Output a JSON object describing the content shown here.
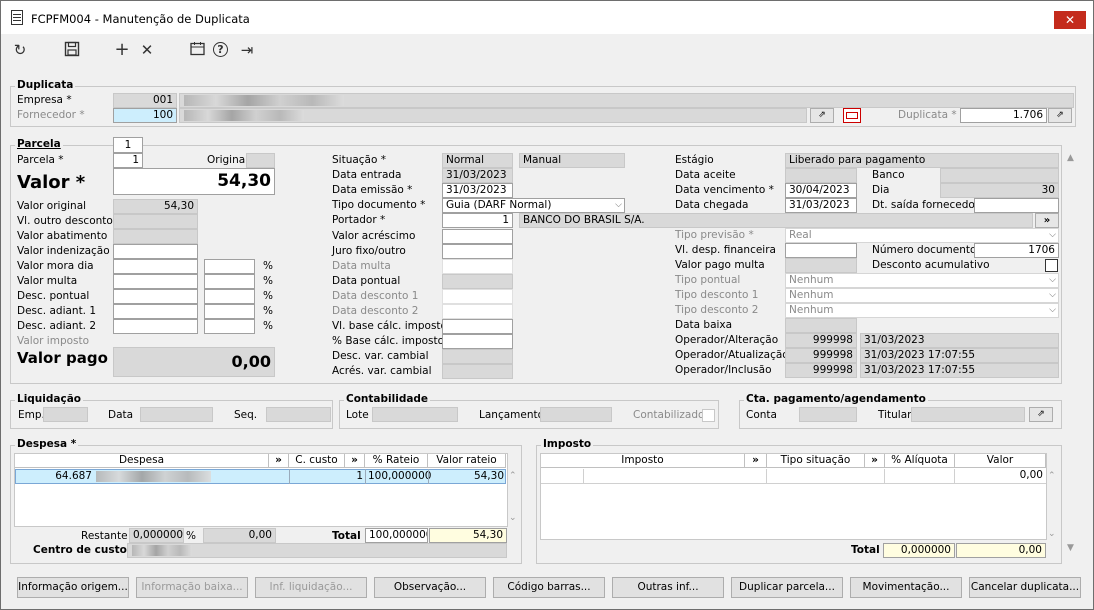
{
  "window": {
    "title": "FCPFM004 - Manutenção de Duplicata"
  },
  "toolbar": {
    "refresh": "↻",
    "save": "💾",
    "add": "+",
    "delete": "✕",
    "calendar": "📅",
    "help": "?",
    "exit": "⇥"
  },
  "duplicata": {
    "section": "Duplicata",
    "empresa_label": "Empresa *",
    "empresa": "001",
    "fornecedor_label": "Fornecedor *",
    "fornecedor": "100",
    "duplicata_label": "Duplicata *",
    "duplicata": "1.706"
  },
  "parcela": {
    "section": "Parcela",
    "tab": "1",
    "parcela_label": "Parcela *",
    "parcela": "1",
    "original_label": "Original",
    "valor_label": "Valor *",
    "valor": "54,30",
    "rows": [
      {
        "label": "Valor original",
        "value": "54,30"
      },
      {
        "label": "Vl. outro desconto",
        "value": ""
      },
      {
        "label": "Valor abatimento",
        "value": ""
      },
      {
        "label": "Valor indenização",
        "value": ""
      },
      {
        "label": "Valor mora dia",
        "value": ""
      },
      {
        "label": "Valor multa",
        "value": ""
      },
      {
        "label": "Desc. pontual",
        "value": ""
      },
      {
        "label": "Desc. adiant. 1",
        "value": ""
      },
      {
        "label": "Desc. adiant. 2",
        "value": ""
      },
      {
        "label": "Valor imposto",
        "value": ""
      }
    ],
    "pct": "%",
    "valor_pago_label": "Valor pago",
    "valor_pago": "0,00"
  },
  "mid": {
    "situacao_label": "Situação *",
    "situacao": "Normal",
    "situacao2": "Manual",
    "data_entrada_label": "Data entrada",
    "data_entrada": "31/03/2023",
    "data_emissao_label": "Data emissão *",
    "data_emissao": "31/03/2023",
    "tipo_doc_label": "Tipo documento *",
    "tipo_doc": "Guia (DARF Normal)",
    "portador_label": "Portador *",
    "portador": "1",
    "portador_nome": "BANCO DO BRASIL S/A.",
    "valor_acrescimo_label": "Valor acréscimo",
    "juro_label": "Juro fixo/outro",
    "data_multa_label": "Data multa",
    "data_pontual_label": "Data pontual",
    "data_desc1_label": "Data desconto 1",
    "data_desc2_label": "Data desconto 2",
    "vl_base_label": "Vl. base cálc. imposto",
    "pct_base_label": "% Base cálc. imposto",
    "desc_var_label": "Desc. var. cambial",
    "acres_var_label": "Acrés. var. cambial"
  },
  "right": {
    "estagio_label": "Estágio",
    "estagio": "Liberado para pagamento",
    "data_aceite_label": "Data aceite",
    "banco_label": "Banco",
    "data_venc_label": "Data vencimento *",
    "data_venc": "30/04/2023",
    "dia_label": "Dia",
    "dia": "30",
    "data_chegada_label": "Data chegada",
    "data_chegada": "31/03/2023",
    "dt_saida_label": "Dt. saída fornecedor",
    "tipo_previsao_label": "Tipo previsão *",
    "tipo_previsao": "Real",
    "vl_desp_label": "Vl. desp. financeira",
    "numero_doc_label": "Número documento",
    "numero_doc": "1706",
    "valor_pago_multa_label": "Valor pago multa",
    "desconto_acum_label": "Desconto acumulativo",
    "tipo_pontual_label": "Tipo pontual",
    "tipo_pontual": "Nenhum",
    "tipo_desc1_label": "Tipo desconto 1",
    "tipo_desc1": "Nenhum",
    "tipo_desc2_label": "Tipo desconto 2",
    "tipo_desc2": "Nenhum",
    "data_baixa_label": "Data baixa",
    "op_alt_label": "Operador/Alteração",
    "op_alt": "999998",
    "op_alt_date": "31/03/2023",
    "op_atu_label": "Operador/Atualização",
    "op_atu": "999998",
    "op_atu_date": "31/03/2023 17:07:55",
    "op_inc_label": "Operador/Inclusão",
    "op_inc": "999998",
    "op_inc_date": "31/03/2023 17:07:55"
  },
  "liquidacao": {
    "section": "Liquidação",
    "emp_label": "Emp.",
    "data_label": "Data",
    "seq_label": "Seq."
  },
  "contabilidade": {
    "section": "Contabilidade",
    "lote_label": "Lote",
    "lancamento_label": "Lançamento",
    "contabilizado_label": "Contabilizado"
  },
  "cta": {
    "section": "Cta. pagamento/agendamento",
    "conta_label": "Conta",
    "titular_label": "Titular"
  },
  "despesa": {
    "section": "Despesa *",
    "headers": [
      "Despesa",
      "»",
      "C. custo",
      "»",
      "% Rateio",
      "Valor rateio"
    ],
    "row": {
      "code": "64.687",
      "ccusto": "1",
      "rateio": "100,000000",
      "valor": "54,30"
    },
    "restante_label": "Restante",
    "restante_pct": "0,000000",
    "restante_valor": "0,00",
    "total_label": "Total",
    "total_pct": "100,000000",
    "total_valor": "54,30",
    "centro_label": "Centro de custo:"
  },
  "imposto": {
    "section": "Imposto",
    "headers": [
      "Imposto",
      "»",
      "Tipo situação",
      "»",
      "% Alíquota",
      "Valor"
    ],
    "row_valor": "0,00",
    "total_label": "Total",
    "total_pct": "0,000000",
    "total_valor": "0,00"
  },
  "buttons": [
    "Informação origem...",
    "Informação baixa...",
    "Inf. liquidação...",
    "Observação...",
    "Código barras...",
    "Outras inf...",
    "Duplicar parcela...",
    "Movimentação...",
    "Cancelar duplicata..."
  ]
}
